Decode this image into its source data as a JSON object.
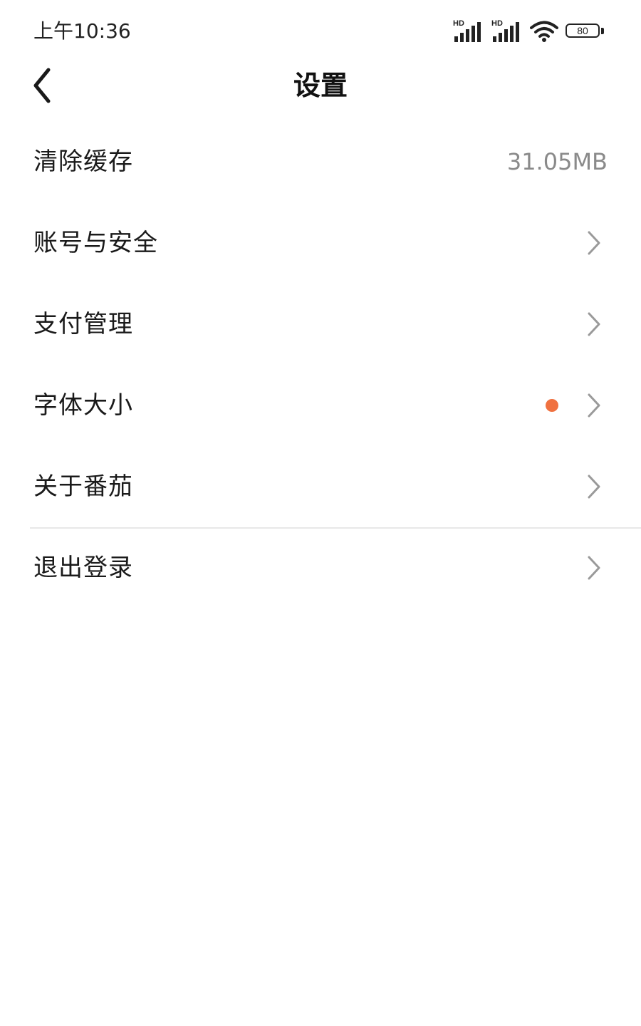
{
  "status_bar": {
    "time": "上午10:36",
    "signal_1_label": "HD",
    "signal_2_label": "HD",
    "battery_level": "80",
    "icons": [
      "signal-icon",
      "signal-icon",
      "wifi-icon",
      "battery-icon"
    ]
  },
  "header": {
    "back_icon": "chevron-left-icon",
    "title": "设置"
  },
  "settings": {
    "items": [
      {
        "label": "清除缓存",
        "value": "31.05MB"
      },
      {
        "label": "账号与安全"
      },
      {
        "label": "支付管理"
      },
      {
        "label": "字体大小",
        "badge": "dot"
      },
      {
        "label": "关于番茄"
      },
      {
        "label": "退出登录"
      }
    ]
  },
  "colors": {
    "accent_dot": "#f07140",
    "secondary_text": "#8a8a8a",
    "chevron": "#9a9a9a",
    "divider": "#e8e8e8"
  }
}
